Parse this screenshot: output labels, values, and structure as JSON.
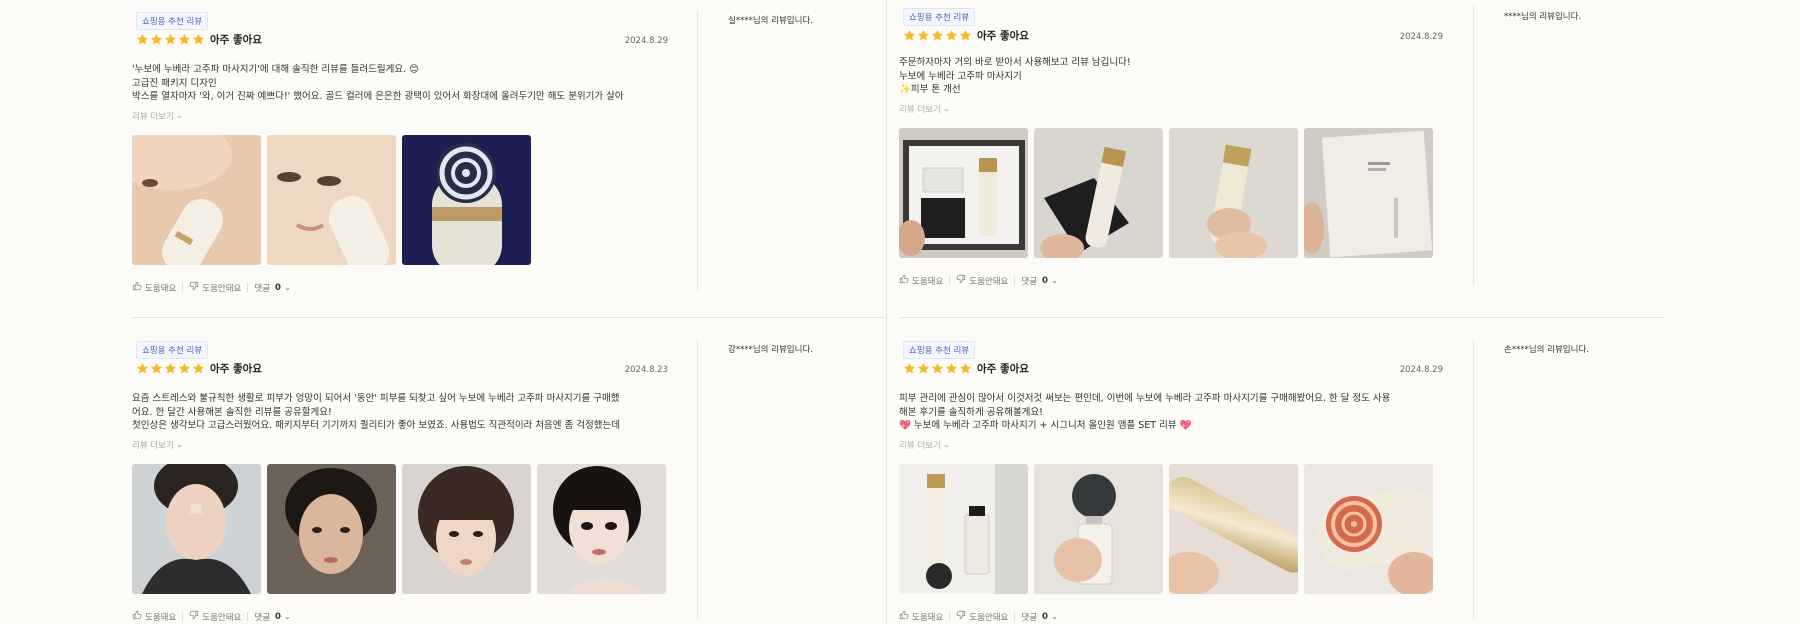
{
  "common": {
    "badge": "쇼핑용 추천 리뷰",
    "rating_label": "아주 좋아요",
    "more": "리뷰 더보기",
    "helpful": "도움돼요",
    "not_helpful": "도움안돼요",
    "comments": "댓글",
    "star_color": "#f7b928"
  },
  "reviews": [
    {
      "date": "2024.8.29",
      "reviewer": "실****님의 리뷰입니다.",
      "lines": [
        "'누보에 누베라 고주파 마사지기'에 대해 솔직한 리뷰를 들려드릴게요. 😊",
        "고급진 패키지 디자인",
        "박스를 열자마자 '와, 이거 진짜 예쁘다!' 했어요. 골드 컬러에 은은한 광택이 있어서 화장대에 올려두기만 해도 분위기가 살아"
      ],
      "comment_count": "0",
      "photos": [
        "face-with-device",
        "cheek-with-device",
        "device-light-head"
      ]
    },
    {
      "date": "2024.8.29",
      "reviewer": "****님의 리뷰입니다.",
      "lines": [
        "주문하자마자 거의 바로 받아서 사용해보고 리뷰 남깁니다!",
        "누보에 누베라 고주파 마사지기",
        "✨피부 톤 개선"
      ],
      "comment_count": "0",
      "photos": [
        "opened-gift-box",
        "device-on-pouch",
        "device-in-hand",
        "brand-box"
      ]
    },
    {
      "date": "2024.8.23",
      "reviewer": "강****님의 리뷰입니다.",
      "lines": [
        "요즘 스트레스와 불규칙한 생활로 피부가 엉망이 되어서 '동안' 피부를 되찾고 싶어 누보에 누베라 고주파 마사지기를 구매했",
        "어요. 한 달간 사용해본 솔직한 리뷰를 공유할게요!",
        "첫인상은 생각보다 고급스러웠어요. 패키지부터 기기까지 퀄리티가 좋아 보였죠. 사용법도 직관적이라 처음엔 좀 걱정했는데"
      ],
      "comment_count": "0",
      "photos": [
        "portrait-hoodie",
        "portrait-short-hair",
        "portrait-bangs",
        "portrait-bob"
      ]
    },
    {
      "date": "2024.8.29",
      "reviewer": "손****님의 리뷰입니다.",
      "lines": [
        "피부 관리에 관심이 많아서 이것저것 써보는 편인데, 이번에 누보에 누베라 고주파 마사지기를 구매해봤어요. 한 달 정도 사용",
        "해본 후기를 솔직하게 공유해볼게요!",
        "💖 누보에 누베라 고주파 마사지기 + 시그니처 올인원 앰플 SET 리뷰 💖"
      ],
      "comment_count": "0",
      "photos": [
        "device-with-ampoule",
        "ampoule-in-hand",
        "device-gold-closeup",
        "device-red-light"
      ]
    }
  ]
}
